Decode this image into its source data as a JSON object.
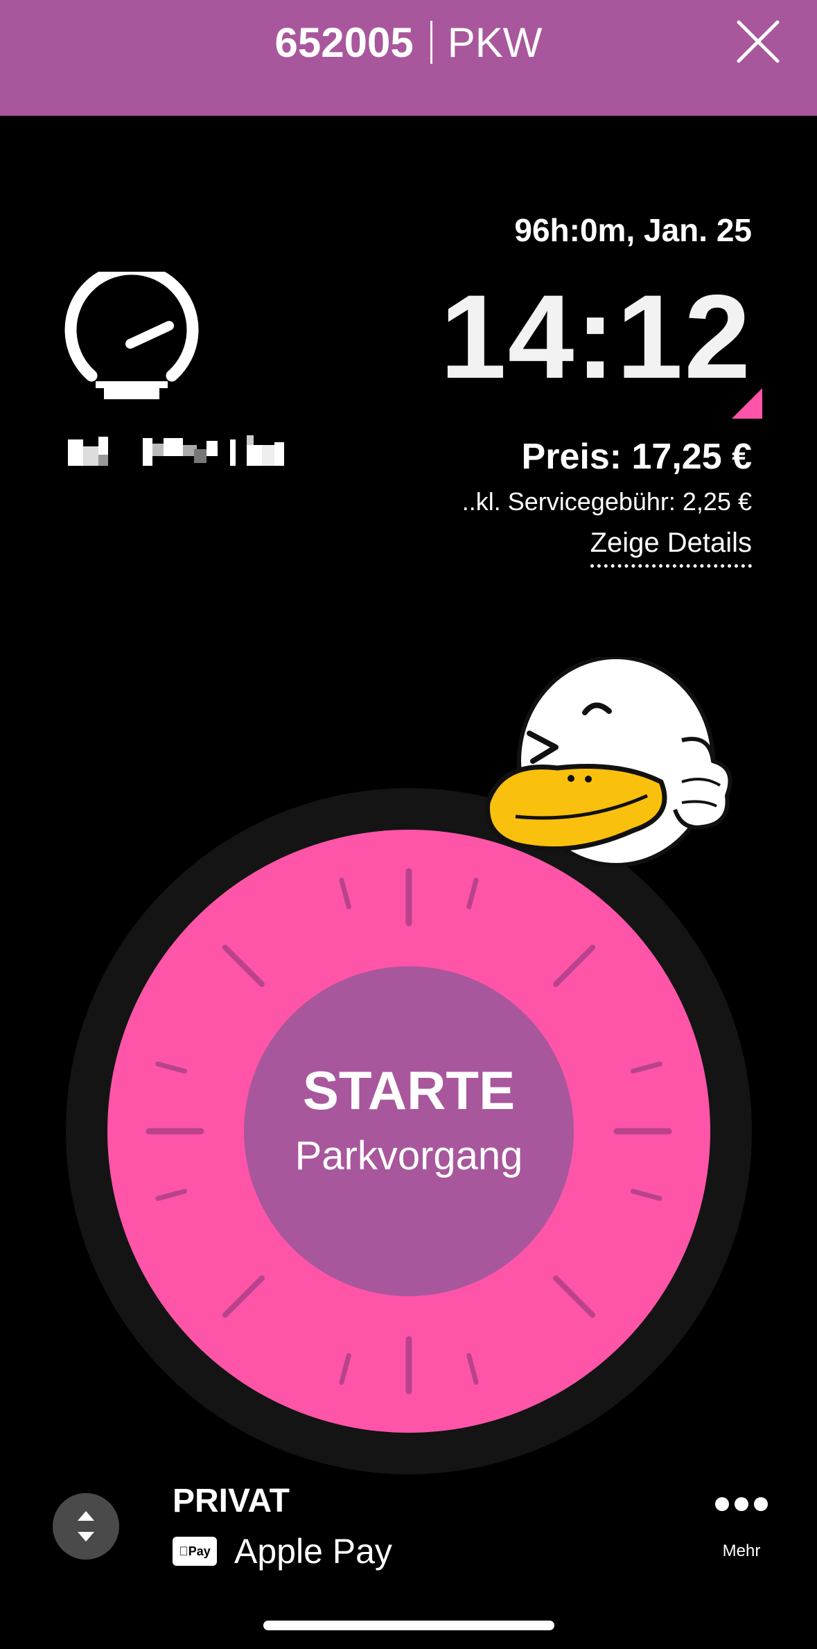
{
  "header": {
    "zone": "652005",
    "vehicle_type": "PKW",
    "close_icon": "close-icon"
  },
  "parking": {
    "duration": "96h:0m, Jan. 25",
    "end_time": "14:12",
    "price": "Preis: 17,25 €",
    "fee": "..kl. Servicegebühr: 2,25 €",
    "details_link": "Zeige Details"
  },
  "gauge_icon": "speedometer-icon",
  "sticker": "duck-sticker",
  "start_button": {
    "title": "STARTE",
    "subtitle": "Parkvorgang"
  },
  "payment": {
    "account": "PRIVAT",
    "method": "Apple Pay",
    "badge_text": "Pay",
    "switch_icon": "up-down-chevron-icon",
    "more_label": "Mehr",
    "more_icon": "more-dots-icon"
  },
  "colors": {
    "header": "#A8579C",
    "dial_pink": "#FF55A8",
    "center": "#A8579C",
    "dial_ring": "#141414",
    "background": "#000000"
  }
}
